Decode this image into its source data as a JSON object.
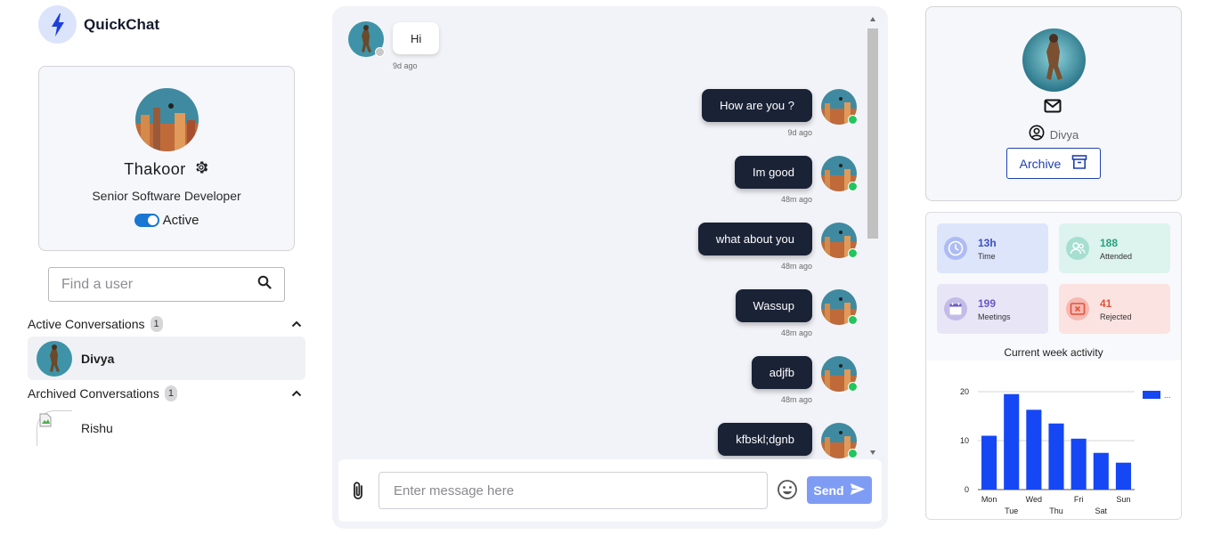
{
  "app": {
    "name": "QuickChat"
  },
  "profile": {
    "name": "Thakoor",
    "role": "Senior Software Developer",
    "status_label": "Active",
    "status_on": true
  },
  "search": {
    "placeholder": "Find a user"
  },
  "sidebar": {
    "active_title": "Active Conversations",
    "active_count": "1",
    "active_items": [
      {
        "name": "Divya"
      }
    ],
    "archived_title": "Archived Conversations",
    "archived_count": "1",
    "archived_items": [
      {
        "name": "Rishu"
      }
    ]
  },
  "chat": {
    "messages": [
      {
        "direction": "in",
        "text": "Hi",
        "time": "9d ago"
      },
      {
        "direction": "out",
        "text": "How are you ?",
        "time": "9d ago"
      },
      {
        "direction": "out",
        "text": "Im good",
        "time": "48m ago"
      },
      {
        "direction": "out",
        "text": "what about you",
        "time": "48m ago"
      },
      {
        "direction": "out",
        "text": "Wassup",
        "time": "48m ago"
      },
      {
        "direction": "out",
        "text": "adjfb",
        "time": "48m ago"
      },
      {
        "direction": "out",
        "text": "kfbskl;dgnb",
        "time": ""
      }
    ],
    "composer": {
      "placeholder": "Enter message here",
      "send_label": "Send"
    }
  },
  "contact": {
    "name": "Divya",
    "archive_label": "Archive"
  },
  "stats": [
    {
      "value": "13h",
      "label": "Time",
      "bg": "#dde5fb",
      "icon_bg": "#aebcf3",
      "color": "#3b4fc4",
      "icon": "clock-icon"
    },
    {
      "value": "188",
      "label": "Attended",
      "bg": "#dcf3ee",
      "icon_bg": "#a6dfcf",
      "color": "#25a37c",
      "icon": "users-icon"
    },
    {
      "value": "199",
      "label": "Meetings",
      "bg": "#e8e6f6",
      "icon_bg": "#c3bce8",
      "color": "#6b57c7",
      "icon": "calendar-icon"
    },
    {
      "value": "41",
      "label": "Rejected",
      "bg": "#fbe3e1",
      "icon_bg": "#f6b9b1",
      "color": "#e0533c",
      "icon": "reject-icon"
    }
  ],
  "chart_title": "Current week activity",
  "chart_data": {
    "type": "bar",
    "title": "Current week activity",
    "categories": [
      "Mon",
      "Tue",
      "Wed",
      "Thu",
      "Fri",
      "Sat",
      "Sun"
    ],
    "values": [
      11,
      19.5,
      16.3,
      13.5,
      10.4,
      7.5,
      5.5
    ],
    "y_ticks": [
      0,
      10,
      20
    ],
    "ylim": [
      0,
      20
    ],
    "legend_label": "...",
    "color": "#1547f5",
    "grid": true
  }
}
